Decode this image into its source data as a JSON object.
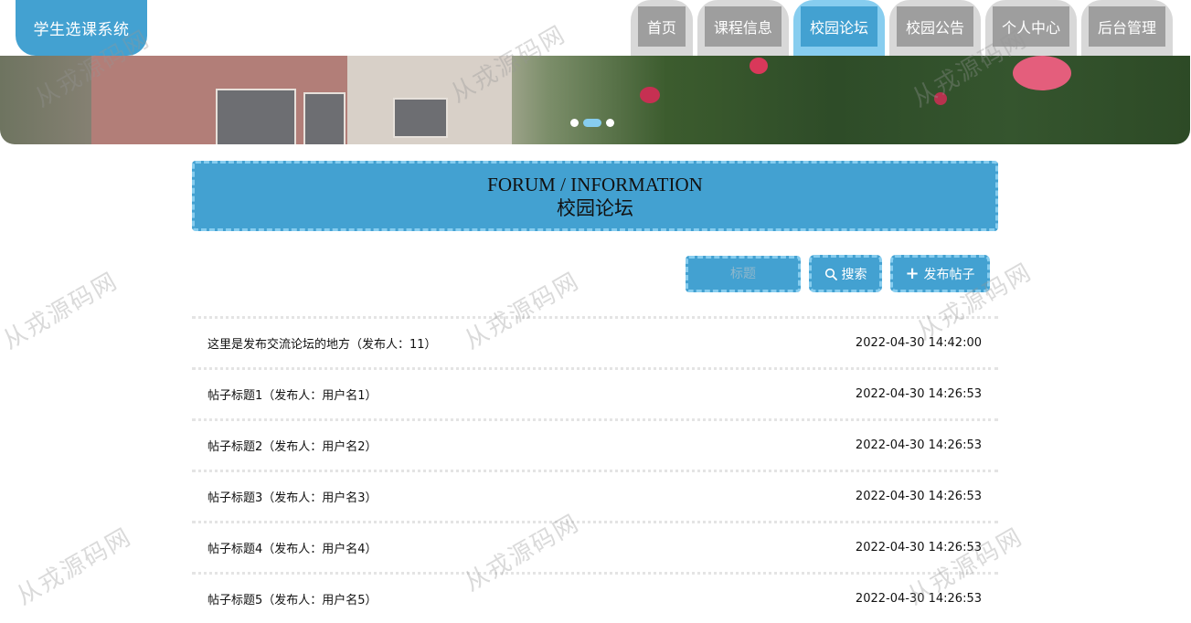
{
  "app": {
    "title": "学生选课系统"
  },
  "nav": {
    "items": [
      {
        "label": "首页",
        "active": false
      },
      {
        "label": "课程信息",
        "active": false
      },
      {
        "label": "校园论坛",
        "active": true
      },
      {
        "label": "校园公告",
        "active": false
      },
      {
        "label": "个人中心",
        "active": false
      },
      {
        "label": "后台管理",
        "active": false
      }
    ]
  },
  "carousel": {
    "slide_count": 3,
    "active_index": 1
  },
  "section": {
    "title_en": "FORUM / INFORMATION",
    "title_cn": "校园论坛"
  },
  "search": {
    "placeholder": "标题",
    "search_label": "搜索",
    "publish_label": "发布帖子"
  },
  "posts": [
    {
      "title": "这里是发布交流论坛的地方（发布人：11）",
      "date": "2022-04-30 14:42:00"
    },
    {
      "title": "帖子标题1（发布人：用户名1）",
      "date": "2022-04-30 14:26:53"
    },
    {
      "title": "帖子标题2（发布人：用户名2）",
      "date": "2022-04-30 14:26:53"
    },
    {
      "title": "帖子标题3（发布人：用户名3）",
      "date": "2022-04-30 14:26:53"
    },
    {
      "title": "帖子标题4（发布人：用户名4）",
      "date": "2022-04-30 14:26:53"
    },
    {
      "title": "帖子标题5（发布人：用户名5）",
      "date": "2022-04-30 14:26:53"
    }
  ],
  "watermark": {
    "text": "从戎源码网"
  },
  "colors": {
    "primary": "#43a1d1",
    "accent": "#87cdef",
    "nav_inactive": "#9e9e9e",
    "nav_frame": "#d8d8d8"
  }
}
